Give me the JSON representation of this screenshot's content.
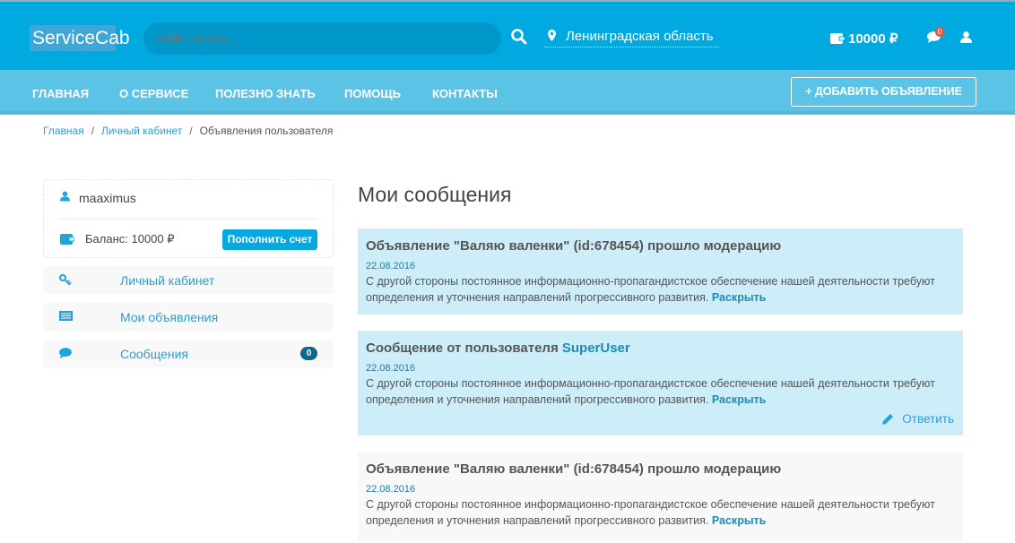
{
  "header": {
    "logo": "ServiceCab",
    "search_placeholder": "Найти услугу...",
    "location": "Ленинградская область",
    "balance": "10000 ₽",
    "messages_count": "0"
  },
  "nav": {
    "items": [
      "ГЛАВНАЯ",
      "О СЕРВИСЕ",
      "ПОЛЕЗНО ЗНАТЬ",
      "ПОМОЩЬ",
      "КОНТАКТЫ"
    ],
    "add_button": "+ ДОБАВИТЬ ОБЪЯВЛЕНИЕ"
  },
  "breadcrumb": [
    "Главная",
    "Личный кабинет",
    "Объявления пользователя"
  ],
  "sidebar": {
    "username": "maaximus",
    "balance": "Баланс: 10000 ₽",
    "topup": "Пополнить счет",
    "menu": [
      {
        "label": "Личный кабинет"
      },
      {
        "label": "Мои объявления"
      },
      {
        "label": "Сообщения",
        "count": "0"
      }
    ]
  },
  "main": {
    "title": "Мои сообщения",
    "messages": [
      {
        "title": "Объявление \"Валяю валенки\" (id:678454) прошло модерацию",
        "date": "22.08.2016",
        "text": "С другой стороны постоянное информационно-пропагандистское обеспечение нашей деятельности требуют определения и уточнения направлений прогрессивного развития.",
        "more": "Раскрыть"
      },
      {
        "title": "Сообщение от пользователя ",
        "user": "SuperUser",
        "date": "22.08.2016",
        "text": "С другой стороны постоянное информационно-пропагандистское обеспечение нашей деятельности требуют определения и уточнения направлений прогрессивного развития.",
        "more": "Раскрыть",
        "reply": "Ответить"
      },
      {
        "title": "Объявление \"Валяю валенки\" (id:678454) прошло модерацию",
        "date": "22.08.2016",
        "text": "С другой стороны постоянное информационно-пропагандистское обеспечение нашей деятельности требуют определения и уточнения направлений прогрессивного развития.",
        "more": "Раскрыть"
      }
    ]
  }
}
